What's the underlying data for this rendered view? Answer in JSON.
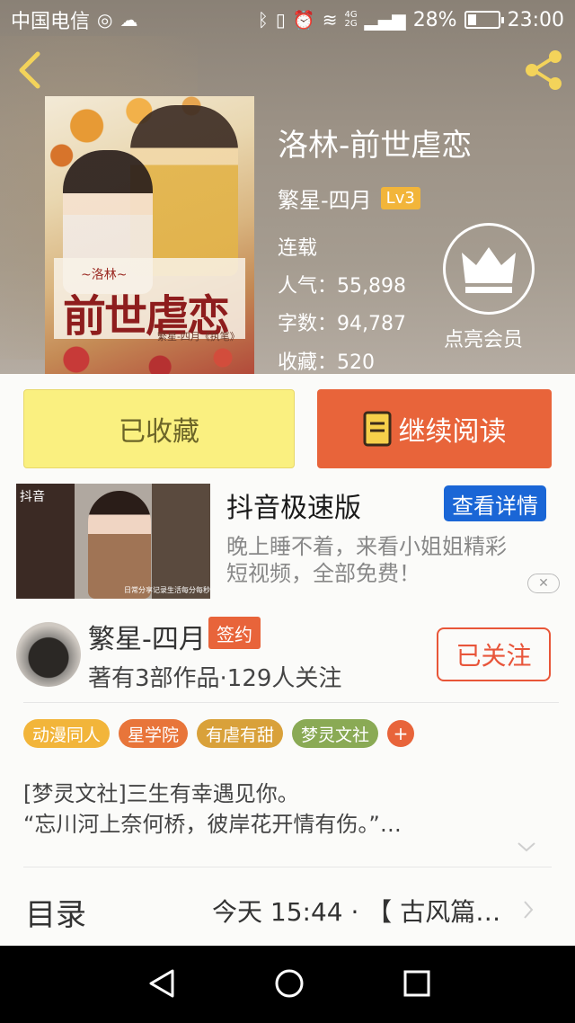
{
  "status_bar": {
    "carrier": "中国电信",
    "network": "4G 2G",
    "battery": "28%",
    "time": "23:00"
  },
  "header": {
    "book_title": "洛林-前世虐恋",
    "author": "繁星-四月",
    "author_level": "Lv3",
    "status": "连载",
    "popularity_label": "人气：",
    "popularity": "55,898",
    "words_label": "字数：",
    "words": "94,787",
    "favorites_label": "收藏：",
    "favorites": "520",
    "vip_label": "点亮会员"
  },
  "cover": {
    "series": "~洛林~",
    "title": "前世虐恋",
    "author": "繁星-四月《执笔》"
  },
  "actions": {
    "collected": "已收藏",
    "continue_reading": "继续阅读"
  },
  "ad": {
    "title": "抖音极速版",
    "detail": "查看详情",
    "desc_line1": "晚上睡不着，来看小姐姐精彩",
    "desc_line2": "短视频，全部免费！",
    "image_brand": "抖音",
    "image_caption": "日常分享记录生活每分每秒"
  },
  "author_card": {
    "name": "繁星-四月",
    "badge": "签约",
    "info": "著有3部作品·129人关注",
    "follow": "已关注"
  },
  "tags": [
    {
      "label": "动漫同人",
      "color": "#f2b53a"
    },
    {
      "label": "星学院",
      "color": "#e8753a"
    },
    {
      "label": "有虐有甜",
      "color": "#d9a13a"
    },
    {
      "label": "梦灵文社",
      "color": "#8aaa55"
    }
  ],
  "tag_add": "+",
  "synopsis": {
    "line1": "[梦灵文社]三生有幸遇见你。",
    "line2": "“忘川河上奈何桥，彼岸花开情有伤。”…"
  },
  "toc": {
    "label": "目录",
    "latest": "今天 15:44 · 【 古风篇…"
  }
}
